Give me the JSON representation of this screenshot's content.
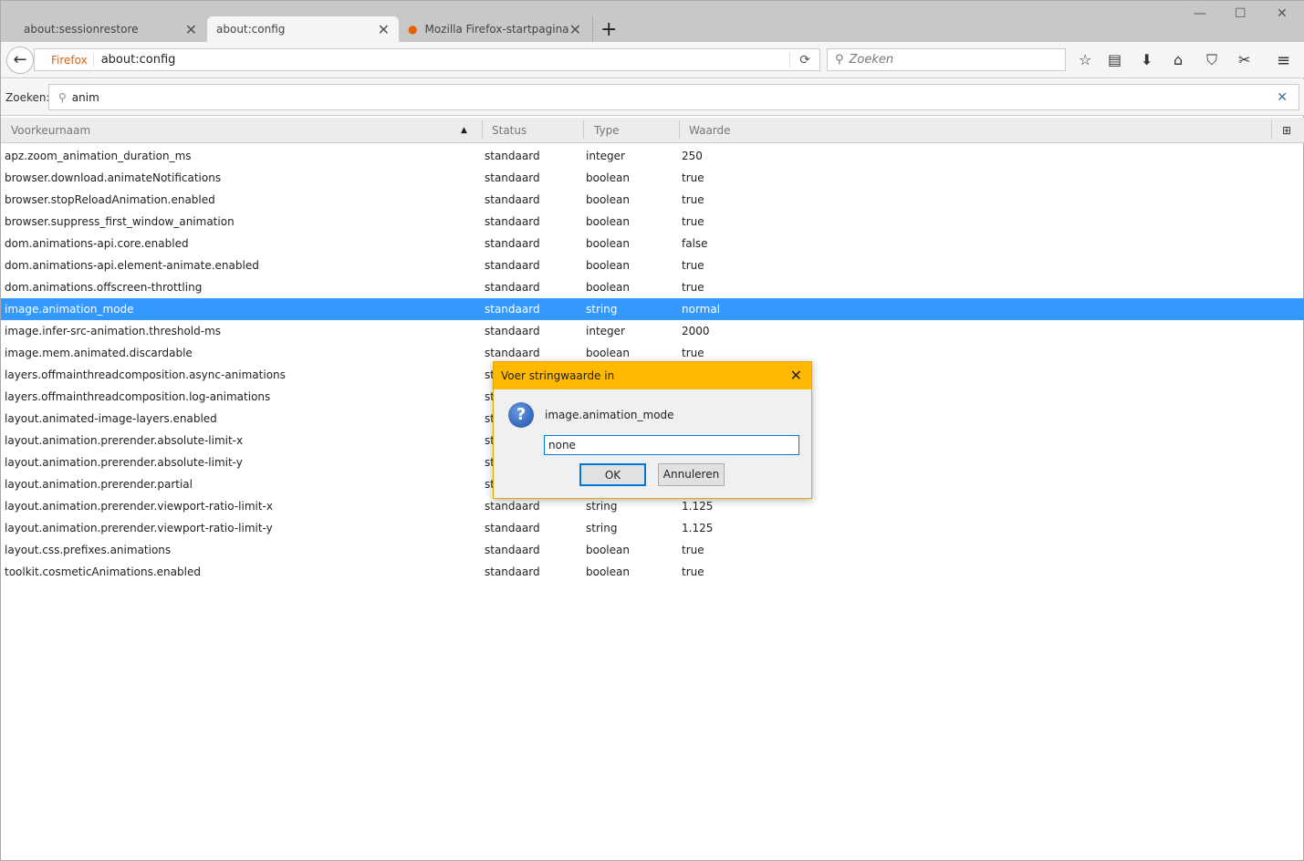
{
  "tabs": [
    {
      "label": "about:sessionrestore",
      "active": false
    },
    {
      "label": "about:config",
      "active": true
    },
    {
      "label": "Mozilla Firefox-startpagina",
      "active": false
    }
  ],
  "nav": {
    "identity": "Firefox",
    "url": "about:config",
    "search_placeholder": "Zoeken"
  },
  "filter": {
    "label": "Zoeken:",
    "value": "anim"
  },
  "columns": [
    "Voorkeurnaam",
    "Status",
    "Type",
    "Waarde"
  ],
  "rows": [
    [
      "apz.zoom_animation_duration_ms",
      "standaard",
      "integer",
      "250"
    ],
    [
      "browser.download.animateNotifications",
      "standaard",
      "boolean",
      "true"
    ],
    [
      "browser.stopReloadAnimation.enabled",
      "standaard",
      "boolean",
      "true"
    ],
    [
      "browser.suppress_first_window_animation",
      "standaard",
      "boolean",
      "true"
    ],
    [
      "dom.animations-api.core.enabled",
      "standaard",
      "boolean",
      "false"
    ],
    [
      "dom.animations-api.element-animate.enabled",
      "standaard",
      "boolean",
      "true"
    ],
    [
      "dom.animations.offscreen-throttling",
      "standaard",
      "boolean",
      "true"
    ],
    [
      "image.animation_mode",
      "standaard",
      "string",
      "normal"
    ],
    [
      "image.infer-src-animation.threshold-ms",
      "standaard",
      "integer",
      "2000"
    ],
    [
      "image.mem.animated.discardable",
      "standaard",
      "boolean",
      "true"
    ],
    [
      "layers.offmainthreadcomposition.async-animations",
      "standaard",
      "",
      ""
    ],
    [
      "layers.offmainthreadcomposition.log-animations",
      "standaard",
      "",
      ""
    ],
    [
      "layout.animated-image-layers.enabled",
      "standaard",
      "",
      ""
    ],
    [
      "layout.animation.prerender.absolute-limit-x",
      "standaard",
      "",
      ""
    ],
    [
      "layout.animation.prerender.absolute-limit-y",
      "standaard",
      "",
      ""
    ],
    [
      "layout.animation.prerender.partial",
      "standaard",
      "",
      ""
    ],
    [
      "layout.animation.prerender.viewport-ratio-limit-x",
      "standaard",
      "string",
      "1.125"
    ],
    [
      "layout.animation.prerender.viewport-ratio-limit-y",
      "standaard",
      "string",
      "1.125"
    ],
    [
      "layout.css.prefixes.animations",
      "standaard",
      "boolean",
      "true"
    ],
    [
      "toolkit.cosmeticAnimations.enabled",
      "standaard",
      "boolean",
      "true"
    ]
  ],
  "selected_row": 7,
  "dialog": {
    "title": "Voer stringwaarde in",
    "message": "image.animation_mode",
    "value": "none",
    "ok": "OK",
    "cancel": "Annuleren"
  },
  "colors": {
    "selection": "#3399ff",
    "dialog_title": "#ffb900",
    "firefox": "#e66000"
  }
}
